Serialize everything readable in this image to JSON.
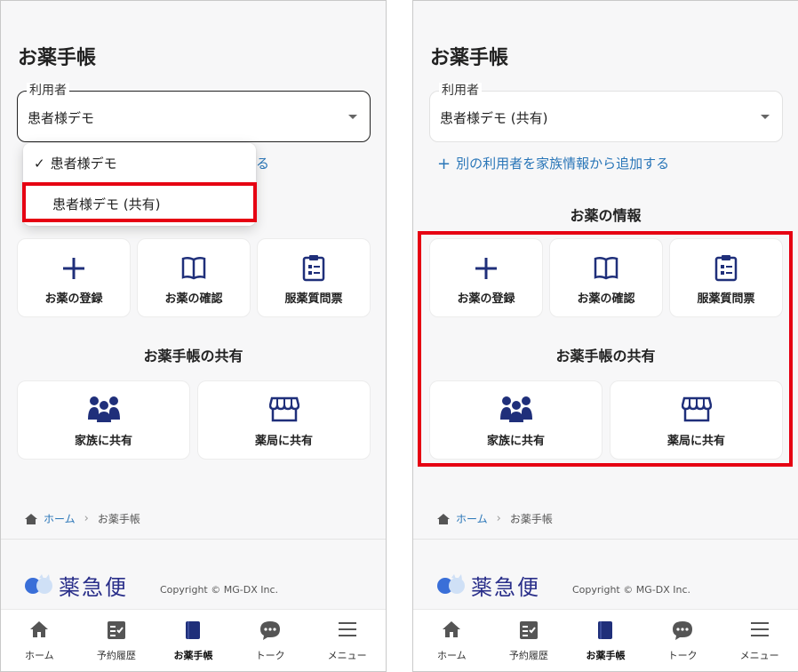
{
  "left": {
    "title": "お薬手帳",
    "select": {
      "legend": "利用者",
      "value": "患者様デモ"
    },
    "dropdown": {
      "check": "✓",
      "item1": "患者様デモ",
      "item2": "患者様デモ (共有)"
    },
    "link_tail": "る",
    "cards": {
      "register": "お薬の登録",
      "confirm": "お薬の確認",
      "questionnaire": "服薬質問票"
    },
    "share_title": "お薬手帳の共有",
    "share": {
      "family": "家族に共有",
      "pharmacy": "薬局に共有"
    },
    "breadcrumb": {
      "home": "ホーム",
      "sep": "›",
      "current": "お薬手帳"
    },
    "logo_text": "薬急便",
    "copyright": "Copyright © MG-DX Inc.",
    "nav": {
      "home": "ホーム",
      "history": "予約履歴",
      "notebook": "お薬手帳",
      "talk": "トーク",
      "menu": "メニュー"
    }
  },
  "right": {
    "title": "お薬手帳",
    "select": {
      "legend": "利用者",
      "value": "患者様デモ (共有)"
    },
    "add_link": {
      "plus": "+",
      "text": "別の利用者を家族情報から追加する"
    },
    "info_title": "お薬の情報",
    "cards": {
      "register": "お薬の登録",
      "confirm": "お薬の確認",
      "questionnaire": "服薬質問票"
    },
    "share_title": "お薬手帳の共有",
    "share": {
      "family": "家族に共有",
      "pharmacy": "薬局に共有"
    },
    "breadcrumb": {
      "home": "ホーム",
      "sep": "›",
      "current": "お薬手帳"
    },
    "logo_text": "薬急便",
    "copyright": "Copyright © MG-DX Inc.",
    "nav": {
      "home": "ホーム",
      "history": "予約履歴",
      "notebook": "お薬手帳",
      "talk": "トーク",
      "menu": "メニュー"
    }
  },
  "colors": {
    "brand_navy": "#1f2f7a",
    "link_blue": "#2a76b8",
    "highlight_red": "#e60012"
  }
}
